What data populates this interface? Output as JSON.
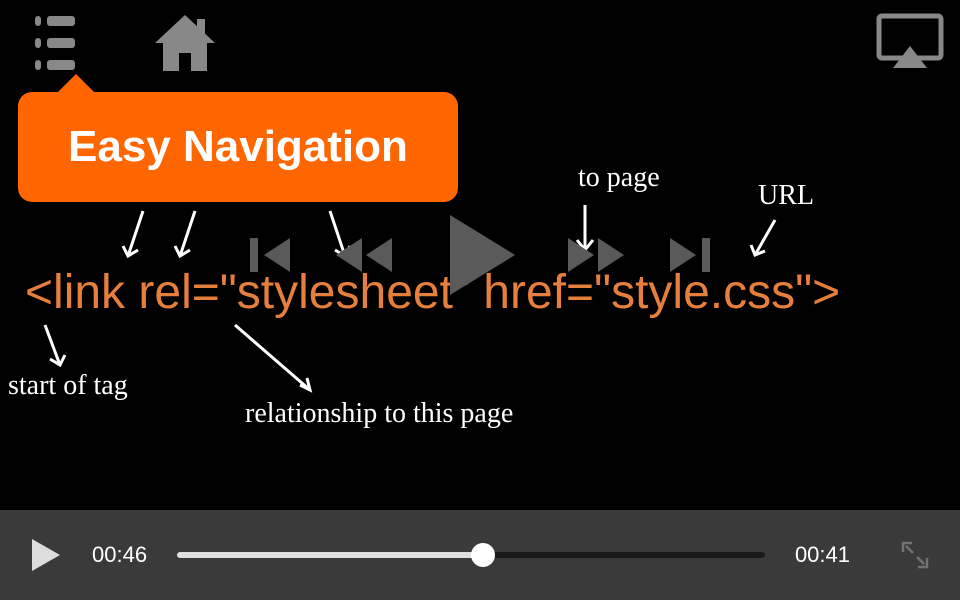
{
  "tooltip": {
    "title": "Easy Navigation"
  },
  "annotations": {
    "to_page": "to page",
    "url": "URL",
    "start_of_tag": "start of tag",
    "relationship": "relationship to this page"
  },
  "code": {
    "line": "<link rel=\"stylesheet\" href=\"style.css\">"
  },
  "player": {
    "elapsed": "00:46",
    "remaining": "00:41",
    "progress_percent": 52
  },
  "colors": {
    "accent": "#FF6600",
    "code": "#E67E3C"
  }
}
